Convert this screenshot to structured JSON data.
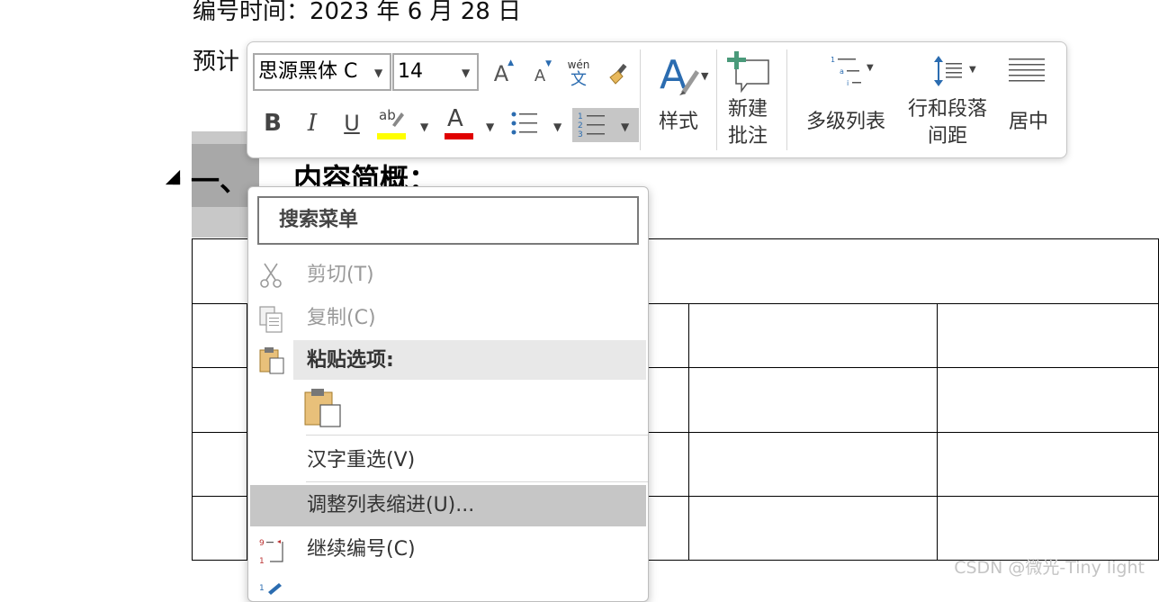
{
  "document": {
    "line1": "编号时间：2023 年 6 月 28 日",
    "line2": "预计",
    "heading_number": "一、",
    "heading_text": "内容简概："
  },
  "mini_toolbar": {
    "font_name": "思源黑体 C",
    "font_size": "14",
    "grow_font_label": "A",
    "shrink_font_label": "A",
    "phonetic_top": "wén",
    "phonetic_bottom": "文",
    "bold_label": "B",
    "italic_label": "I",
    "underline_label": "U",
    "highlight_label": "ab",
    "font_color_label": "A",
    "styles_label": "样式",
    "new_comment_label_line1": "新建",
    "new_comment_label_line2": "批注",
    "multilevel_list_label": "多级列表",
    "line_spacing_label_line1": "行和段落",
    "line_spacing_label_line2": "间距",
    "center_label": "居中",
    "highlight_color": "#ffff00",
    "font_color": "#e00000"
  },
  "context_menu": {
    "search_placeholder": "搜索菜单",
    "items": [
      {
        "label": "剪切(T)",
        "icon": "scissors-icon",
        "enabled": false
      },
      {
        "label": "复制(C)",
        "icon": "copy-icon",
        "enabled": false
      },
      {
        "label": "粘贴选项:",
        "icon": "clipboard-icon",
        "enabled": true
      },
      {
        "label": "汉字重选(V)",
        "icon": "",
        "enabled": true
      },
      {
        "label": "调整列表缩进(U)...",
        "icon": "",
        "enabled": true
      },
      {
        "label": "继续编号(C)",
        "icon": "continue-numbering-icon",
        "enabled": true
      }
    ]
  },
  "watermark": "CSDN @微光-Tiny light"
}
